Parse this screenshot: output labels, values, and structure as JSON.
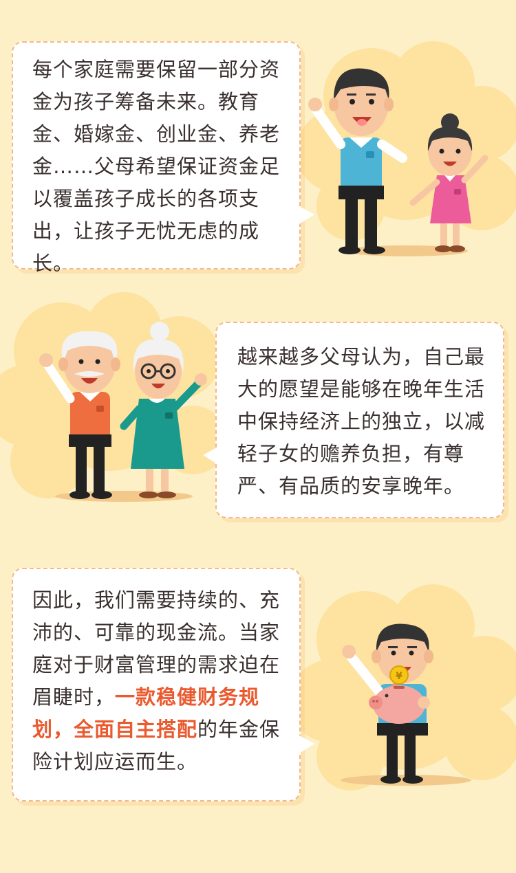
{
  "sections": [
    {
      "text": "每个家庭需要保留一部分资金为孩子筹备未来。教育金、婚嫁金、创业金、养老金……父母希望保证资金足以覆盖孩子成长的各项支出，让孩子无忧无虑的成长。"
    },
    {
      "text": "越来越多父母认为，自己最大的愿望是能够在晚年生活中保持经济上的独立，以减轻子女的赡养负担，有尊严、有品质的安享晚年。"
    },
    {
      "text_before": "因此，我们需要持续的、充沛的、可靠的现金流。当家庭对于财富管理的需求迫在眉睫时，",
      "highlight": "一款稳健财务规划，全面自主搭配",
      "text_after": "的年金保险计划应运而生。"
    }
  ],
  "colors": {
    "background": "#fdf0c6",
    "cloud": "#fde2a0",
    "bubble_border": "#f2b98a",
    "highlight": "#ea5a2e",
    "text": "#3b3030"
  },
  "icons": [
    "father-daughter-illustration",
    "elderly-couple-illustration",
    "man-with-piggy-bank-illustration",
    "coin-icon"
  ]
}
